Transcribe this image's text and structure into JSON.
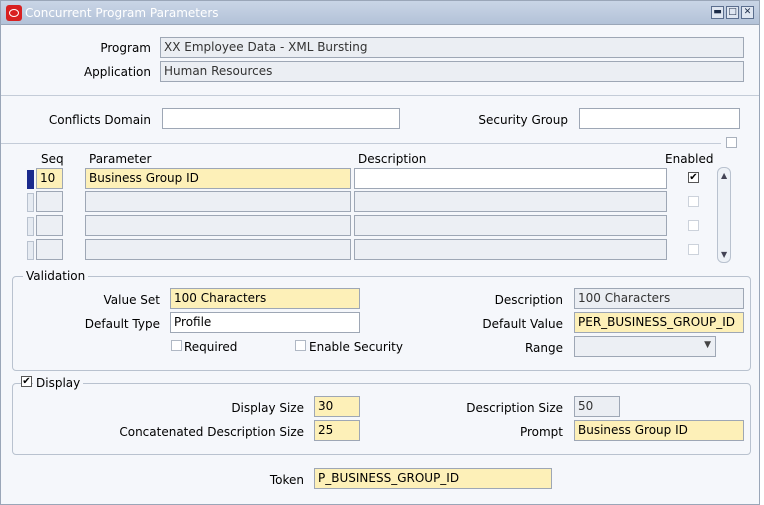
{
  "window": {
    "title": "Concurrent Program Parameters"
  },
  "header": {
    "program_label": "Program",
    "program_value": "XX Employee Data - XML Bursting",
    "application_label": "Application",
    "application_value": "Human Resources"
  },
  "filters": {
    "conflicts_domain_label": "Conflicts Domain",
    "conflicts_domain_value": "",
    "security_group_label": "Security Group",
    "security_group_value": ""
  },
  "grid": {
    "columns": {
      "seq": "Seq",
      "parameter": "Parameter",
      "description": "Description",
      "enabled": "Enabled"
    },
    "rows": [
      {
        "seq": "10",
        "parameter": "Business Group ID",
        "description": "",
        "enabled": true
      },
      {
        "seq": "",
        "parameter": "",
        "description": "",
        "enabled": false
      },
      {
        "seq": "",
        "parameter": "",
        "description": "",
        "enabled": false
      },
      {
        "seq": "",
        "parameter": "",
        "description": "",
        "enabled": false
      }
    ]
  },
  "validation": {
    "title": "Validation",
    "value_set_label": "Value Set",
    "value_set_value": "100 Characters",
    "default_type_label": "Default Type",
    "default_type_value": "Profile",
    "required_label": "Required",
    "enable_security_label": "Enable Security",
    "description_label": "Description",
    "description_value": "100 Characters",
    "default_value_label": "Default Value",
    "default_value_value": "PER_BUSINESS_GROUP_ID",
    "range_label": "Range",
    "range_value": ""
  },
  "display": {
    "title": "Display",
    "checked": true,
    "display_size_label": "Display Size",
    "display_size_value": "30",
    "concat_desc_size_label": "Concatenated Description Size",
    "concat_desc_size_value": "25",
    "description_size_label": "Description Size",
    "description_size_value": "50",
    "prompt_label": "Prompt",
    "prompt_value": "Business Group ID"
  },
  "token": {
    "label": "Token",
    "value": "P_BUSINESS_GROUP_ID"
  },
  "icons": {
    "check": "✔",
    "up": "▲",
    "down": "▼",
    "minimize": "▬",
    "maximize": "□",
    "close": "✕"
  }
}
